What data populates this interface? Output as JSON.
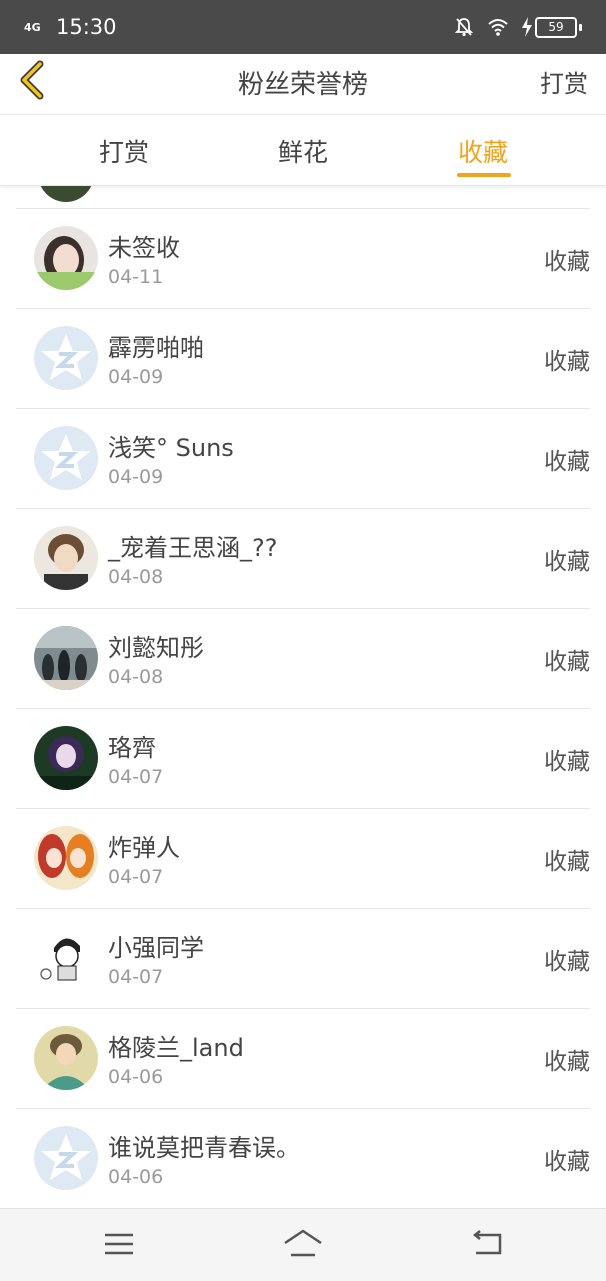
{
  "status_bar": {
    "network": "4G",
    "time": "15:30",
    "battery": "59"
  },
  "header": {
    "title": "粉丝荣誉榜",
    "right_action": "打赏"
  },
  "tabs": [
    {
      "label": "打赏",
      "active": false
    },
    {
      "label": "鲜花",
      "active": false
    },
    {
      "label": "收藏",
      "active": true
    }
  ],
  "colors": {
    "accent": "#f0a41e",
    "status_bar_bg": "#4a4a4a"
  },
  "list": {
    "items": [
      {
        "name": "未签收",
        "date": "04-11",
        "action": "收藏",
        "avatar": "photo-avatar"
      },
      {
        "name": "霹雳啪啪",
        "date": "04-09",
        "action": "收藏",
        "avatar": "default-star-avatar"
      },
      {
        "name": "浅笑° Suns",
        "date": "04-09",
        "action": "收藏",
        "avatar": "default-star-avatar"
      },
      {
        "name": "_宠着王思涵_??",
        "date": "04-08",
        "action": "收藏",
        "avatar": "photo-avatar"
      },
      {
        "name": "刘懿知彤",
        "date": "04-08",
        "action": "收藏",
        "avatar": "photo-avatar"
      },
      {
        "name": "珞齊",
        "date": "04-07",
        "action": "收藏",
        "avatar": "photo-avatar"
      },
      {
        "name": "炸弹人",
        "date": "04-07",
        "action": "收藏",
        "avatar": "photo-avatar"
      },
      {
        "name": "小强同学",
        "date": "04-07",
        "action": "收藏",
        "avatar": "cartoon-avatar"
      },
      {
        "name": "格陵兰_land",
        "date": "04-06",
        "action": "收藏",
        "avatar": "photo-avatar"
      },
      {
        "name": "谁说莫把青春误。",
        "date": "04-06",
        "action": "收藏",
        "avatar": "default-star-avatar"
      }
    ]
  },
  "nav_bar": {
    "icons": [
      "menu-icon",
      "home-icon",
      "back-icon"
    ]
  }
}
